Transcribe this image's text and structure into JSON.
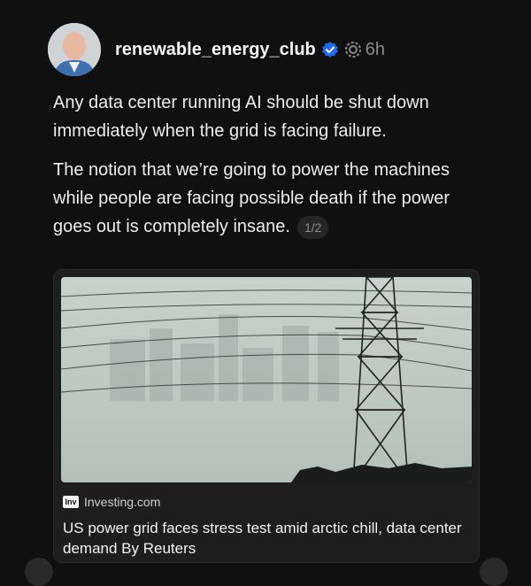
{
  "post": {
    "username": "renewable_energy_club",
    "time": "6h",
    "paragraphs": [
      "Any data center running AI should be shut down immediately when the grid is facing failure.",
      "The notion that we’re going to power the machines while people are facing possible death if the power goes out is completely insane."
    ],
    "page_counter": "1/2"
  },
  "link_card": {
    "source_icon_text": "Inv",
    "source_name": "Investing.com",
    "title": "US power grid faces stress test amid arctic chill, data center demand By Reuters"
  },
  "icons": {
    "verified": "verified-badge-icon",
    "status": "status-ring-icon"
  },
  "colors": {
    "background": "#101010",
    "verified_blue": "#1d6cf0",
    "muted_text": "#8a8a8a"
  }
}
